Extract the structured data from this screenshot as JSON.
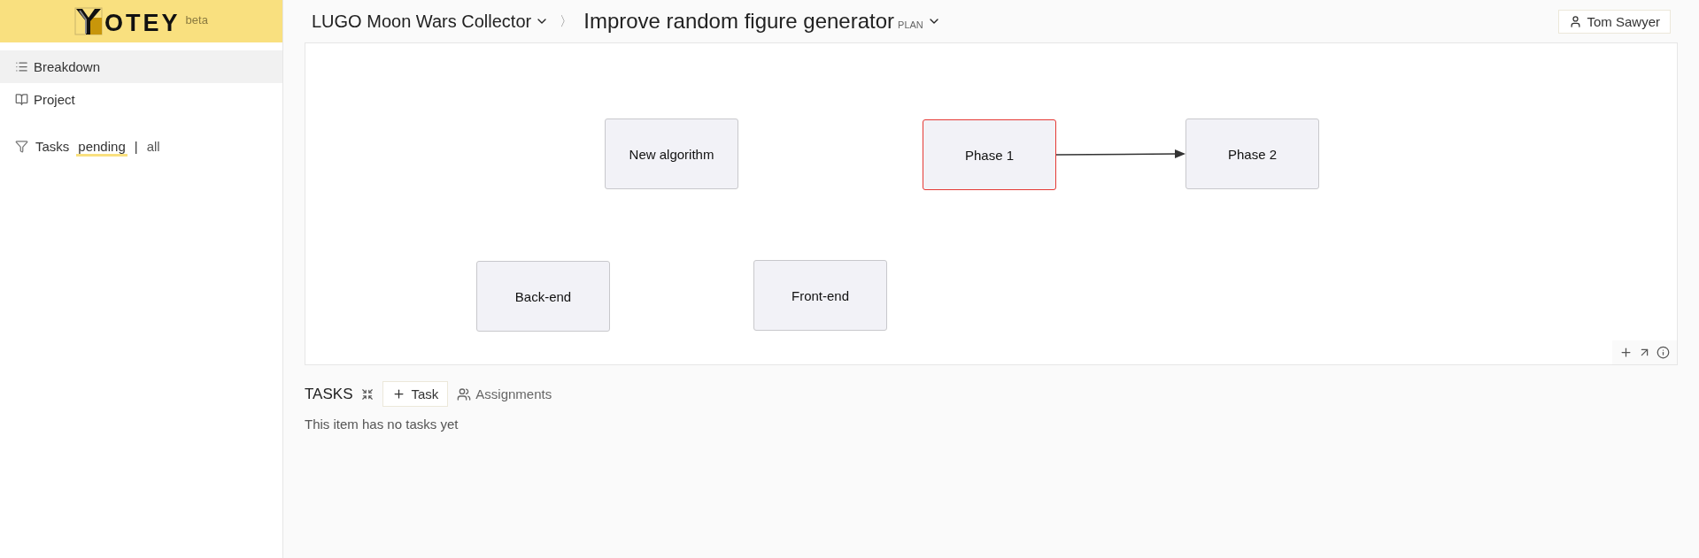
{
  "logo": {
    "text": "OTEY",
    "badge": "beta"
  },
  "sidebar": {
    "items": [
      {
        "label": "Breakdown",
        "selected": true
      },
      {
        "label": "Project",
        "selected": false
      }
    ],
    "filter": {
      "label": "Tasks",
      "options": [
        {
          "label": "pending",
          "selected": true
        },
        {
          "label": "all",
          "selected": false
        }
      ],
      "separator": "|"
    }
  },
  "header": {
    "project": "LUGO Moon Wars Collector",
    "separator": "〉",
    "title": "Improve random figure generator",
    "badge": "PLAN",
    "user": "Tom Sawyer"
  },
  "diagram": {
    "nodes": [
      {
        "label": "New algorithm",
        "selected": false
      },
      {
        "label": "Phase 1",
        "selected": true
      },
      {
        "label": "Phase 2",
        "selected": false
      },
      {
        "label": "Back-end",
        "selected": false
      },
      {
        "label": "Front-end",
        "selected": false
      }
    ]
  },
  "tasks": {
    "title": "TASKS",
    "add_button": "Task",
    "assignments": "Assignments",
    "empty": "This item has no tasks yet"
  }
}
